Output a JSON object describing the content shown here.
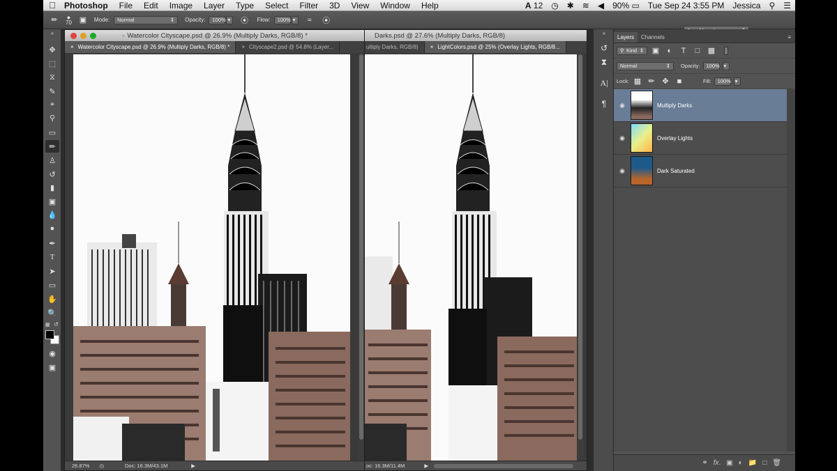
{
  "menubar": {
    "app_name": "Photoshop",
    "items": [
      "File",
      "Edit",
      "Image",
      "Layer",
      "Type",
      "Select",
      "Filter",
      "3D",
      "View",
      "Window",
      "Help"
    ],
    "adobe_badge": "12",
    "battery": "90%",
    "clock": "Tue Sep 24  3:55 PM",
    "user": "Jessica"
  },
  "options_bar": {
    "brush_size": "70",
    "mode_label": "Mode:",
    "mode_value": "Normal",
    "opacity_label": "Opacity:",
    "opacity_value": "100%",
    "flow_label": "Flow:",
    "flow_value": "100%",
    "workspace": "Jess Many Layers"
  },
  "doc_left": {
    "window_title": "Watercolor Cityscape.psd @ 26.9% (Multiply Darks, RGB/8) *",
    "tabs": [
      {
        "label": "Watercolor Cityscape.psd @ 26.9% (Multiply Darks, RGB/8) *",
        "close": "×"
      },
      {
        "label": "Cityscape2.psd @ 54.8% (Layer...",
        "close": "×"
      }
    ],
    "zoom": "26.87%",
    "doc_info": "Doc: 16.3M/43.1M"
  },
  "doc_right": {
    "window_title": "Darks.psd @ 27.6% (Multiply Darks, RGB/8)",
    "tabs": [
      {
        "label": "ultiply Darks, RGB/8)",
        "close": "×"
      },
      {
        "label": "LightColors.psd @ 25% (Overlay Lights, RGB/8...",
        "close": "×"
      }
    ],
    "doc_info": "oc: 16.3M/11.4M"
  },
  "layers_panel": {
    "tabs": [
      "Layers",
      "Channels"
    ],
    "kind_label": "Kind",
    "blend_mode": "Normal",
    "opacity_label": "Opacity:",
    "opacity_value": "100%",
    "lock_label": "Lock:",
    "fill_label": "Fill:",
    "fill_value": "100%",
    "layers": [
      {
        "name": "Multiply Darks",
        "selected": true
      },
      {
        "name": "Overlay Lights",
        "selected": false
      },
      {
        "name": "Dark Saturated",
        "selected": false
      }
    ]
  },
  "colors": {
    "selected_layer": "#6a7d97",
    "panel_bg": "#535353",
    "workspace_bg": "#2c2c2c"
  }
}
